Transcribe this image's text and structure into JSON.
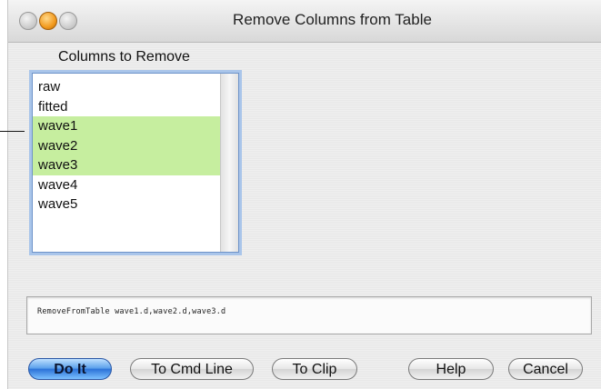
{
  "window": {
    "title": "Remove Columns from Table"
  },
  "list": {
    "label": "Columns to Remove",
    "items": [
      {
        "label": "raw",
        "selected": false
      },
      {
        "label": "fitted",
        "selected": false
      },
      {
        "label": "wave1",
        "selected": true
      },
      {
        "label": "wave2",
        "selected": true
      },
      {
        "label": "wave3",
        "selected": true
      },
      {
        "label": "wave4",
        "selected": false
      },
      {
        "label": "wave5",
        "selected": false
      }
    ]
  },
  "command": {
    "text": "RemoveFromTable wave1.d,wave2.d,wave3.d"
  },
  "buttons": {
    "do_it": "Do It",
    "to_cmd_line": "To Cmd Line",
    "to_clip": "To Clip",
    "help": "Help",
    "cancel": "Cancel"
  },
  "colors": {
    "selection": "#c6ee9f",
    "default_button": "#2c73d8"
  }
}
